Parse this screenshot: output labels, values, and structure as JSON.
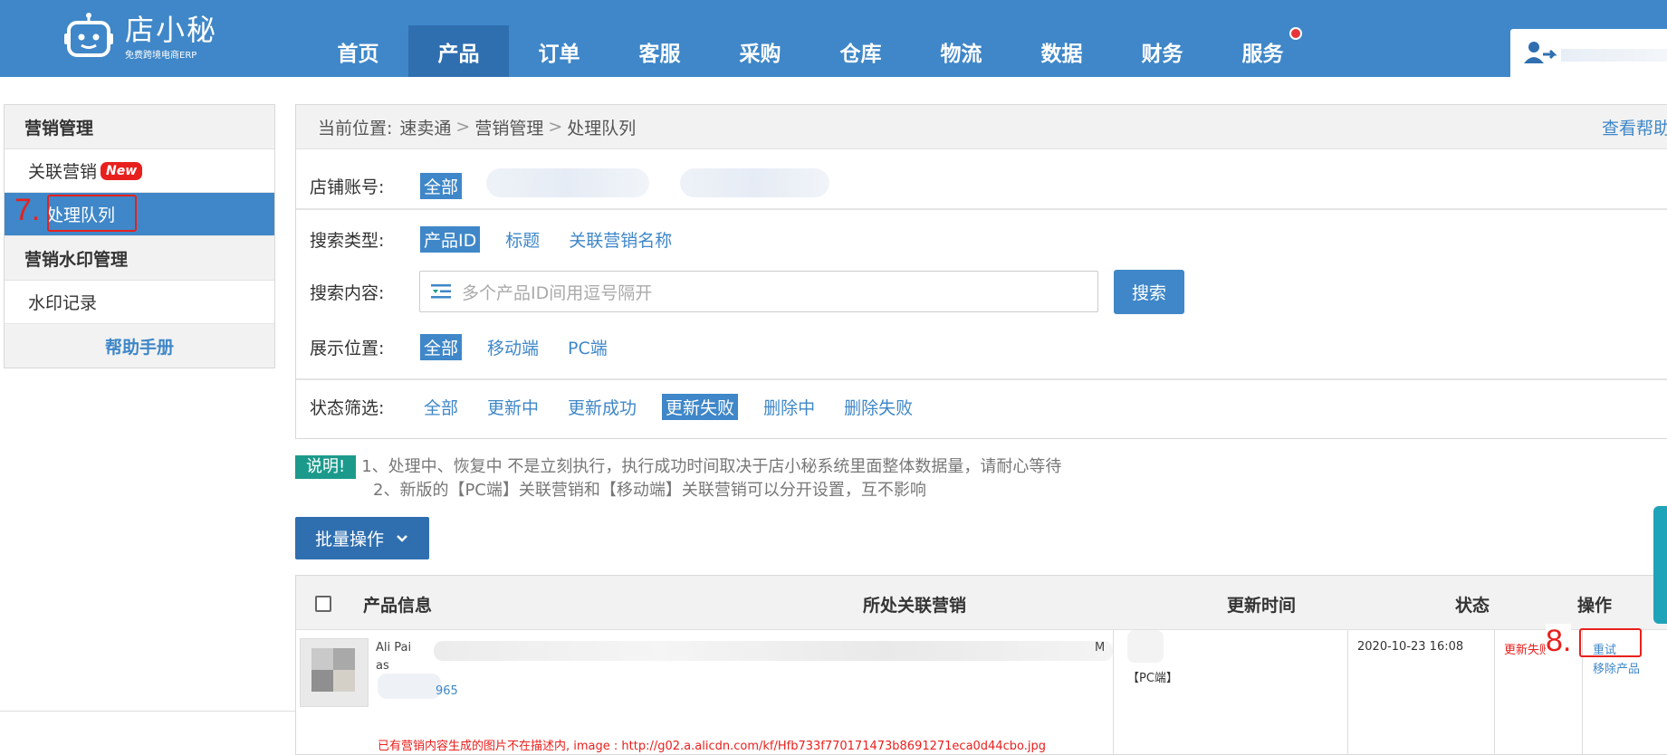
{
  "brand": {
    "name": "店小秘",
    "tagline": "免费跨境电商ERP"
  },
  "nav": [
    {
      "label": "首页"
    },
    {
      "label": "产品",
      "active": true
    },
    {
      "label": "订单"
    },
    {
      "label": "客服"
    },
    {
      "label": "采购"
    },
    {
      "label": "仓库"
    },
    {
      "label": "物流"
    },
    {
      "label": "数据"
    },
    {
      "label": "财务"
    },
    {
      "label": "服务",
      "dot": true
    }
  ],
  "sidebar": {
    "group1": "营销管理",
    "item_related": "关联营销",
    "badge_new": "New",
    "item_queue": "处理队列",
    "group2": "营销水印管理",
    "item_watermark": "水印记录",
    "help": "帮助手册"
  },
  "annotations": {
    "step7": "7.",
    "step8": "8."
  },
  "breadcrumb": {
    "prefix": "当前位置:",
    "c1": "速卖通",
    "c2": "营销管理",
    "c3": "处理队列",
    "sep": ">",
    "help": "查看帮助"
  },
  "filters": {
    "shop": {
      "label": "店铺账号:",
      "options": [
        "全部"
      ]
    },
    "search_type": {
      "label": "搜索类型:",
      "options": [
        "产品ID",
        "标题",
        "关联营销名称"
      ]
    },
    "search_content": {
      "label": "搜索内容:",
      "placeholder": "多个产品ID间用逗号隔开",
      "button": "搜索"
    },
    "display": {
      "label": "展示位置:",
      "options": [
        "全部",
        "移动端",
        "PC端"
      ]
    },
    "status": {
      "label": "状态筛选:",
      "options": [
        "全部",
        "更新中",
        "更新成功",
        "更新失败",
        "删除中",
        "删除失败"
      ]
    }
  },
  "note": {
    "tag": "说明!",
    "line1": "1、处理中、恢复中 不是立刻执行，执行成功时间取决于店小秘系统里面整体数据量，请耐心等待",
    "line2": "2、新版的【PC端】关联营销和【移动端】关联营销可以分开设置，互不影响"
  },
  "batch_button": "批量操作",
  "table": {
    "headers": {
      "product": "产品信息",
      "marketing": "所处关联营销",
      "time": "更新时间",
      "status": "状态",
      "action": "操作"
    },
    "row": {
      "title_fragment": "Ali   Pai",
      "title_end": "M",
      "title_line2": "as",
      "id_fragment": "965",
      "error": "已有营销内容生成的图片不在描述内, image : http://g02.a.alicdn.com/kf/Hfb733f770171473b8691271eca0d44cbo.jpg",
      "marketing": "【PC端】",
      "time": "2020-10-23 16:08",
      "status": "更新失败",
      "action_retry": "重试",
      "action_remove": "移除产品"
    }
  },
  "colors": {
    "primary": "#3f87c8",
    "dark": "#2f6fb0",
    "danger": "#e8201d",
    "teal": "#1b9a8c"
  }
}
